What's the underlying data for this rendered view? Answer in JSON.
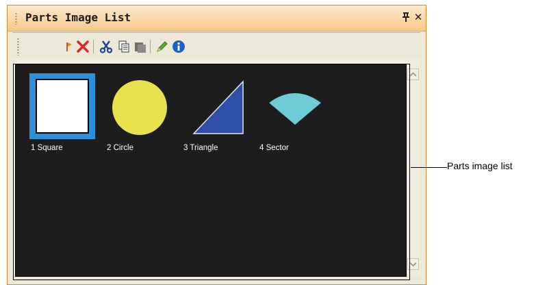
{
  "panel": {
    "title": "Parts Image List",
    "pin_glyph": "Ԅ",
    "close_glyph": "✕"
  },
  "toolbar": {
    "tools": [
      {
        "icon": "flag-icon"
      },
      {
        "icon": "delete-x-icon"
      },
      {
        "icon": "scissors-icon"
      },
      {
        "icon": "copy-icon"
      },
      {
        "icon": "paste-icon"
      },
      {
        "icon": "pencil-icon"
      },
      {
        "icon": "info-icon"
      }
    ]
  },
  "parts": [
    {
      "label": "1 Square",
      "shape": "square",
      "selected": true,
      "color": "#ffffff"
    },
    {
      "label": "2 Circle",
      "shape": "circle",
      "selected": false,
      "color": "#e9e24e"
    },
    {
      "label": "3 Triangle",
      "shape": "triangle",
      "selected": false,
      "color": "#2f4fa8"
    },
    {
      "label": "4 Sector",
      "shape": "sector",
      "selected": false,
      "color": "#6ecbd8"
    }
  ],
  "callout": {
    "label": "Parts image list"
  },
  "colors": {
    "selection": "#2f8ed8",
    "list_background": "#1d1d1d",
    "title_bar": "#f7c98a"
  }
}
